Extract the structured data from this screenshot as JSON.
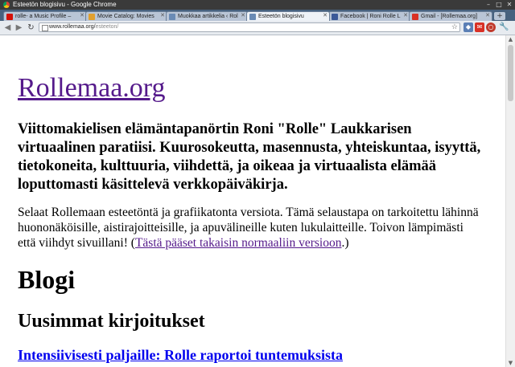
{
  "window": {
    "title": "Esteetön blogisivu - Google Chrome"
  },
  "tabs": [
    {
      "label": "rolle- a Music Profile –",
      "icon": "lastfm-icon",
      "color": "#d51007"
    },
    {
      "label": "Movie Catalog: Movies",
      "icon": "folder-icon",
      "color": "#e0a030"
    },
    {
      "label": "Muokkaa artikkelia ‹ Rol",
      "icon": "page-icon",
      "color": "#6a8bb5"
    },
    {
      "label": "Esteetön blogisivu",
      "icon": "page-icon",
      "color": "#6a8bb5",
      "active": true
    },
    {
      "label": "Facebook | Roni Rolle L",
      "icon": "facebook-icon",
      "color": "#3b5998"
    },
    {
      "label": "Gmail - [Rollemaa.org]",
      "icon": "gmail-icon",
      "color": "#d93025"
    }
  ],
  "address": {
    "host": "www.rollemaa.org/",
    "path": "esteeton/"
  },
  "page": {
    "site_title": "Rollemaa.org",
    "tagline": "Viittomakielisen elämäntapanörtin Roni \"Rolle\" Laukkarisen virtuaalinen paratiisi. Kuurosokeutta, masennusta, yhteiskuntaa, isyyttä, tietokoneita, kulttuuria, viihdettä, ja oikeaa ja virtuaalista elämää loputtomasti käsittelevä verkkopäiväkirja.",
    "intro_text": "Selaat Rollemaan esteetöntä ja grafiikatonta versiota. Tämä selaustapa on tarkoitettu lähinnä huononäköisille, aistirajoitteisille, ja apuvälineille kuten lukulaitteille. Toivon lämpimästi että viihdyt sivuillani! (",
    "intro_link": "Tästä pääset takaisin normaaliin versioon",
    "intro_end": ".)",
    "blog_heading": "Blogi",
    "recent_heading": "Uusimmat kirjoitukset",
    "first_post": "Intensiivisesti paljaille: Rolle raportoi tuntemuksista"
  }
}
